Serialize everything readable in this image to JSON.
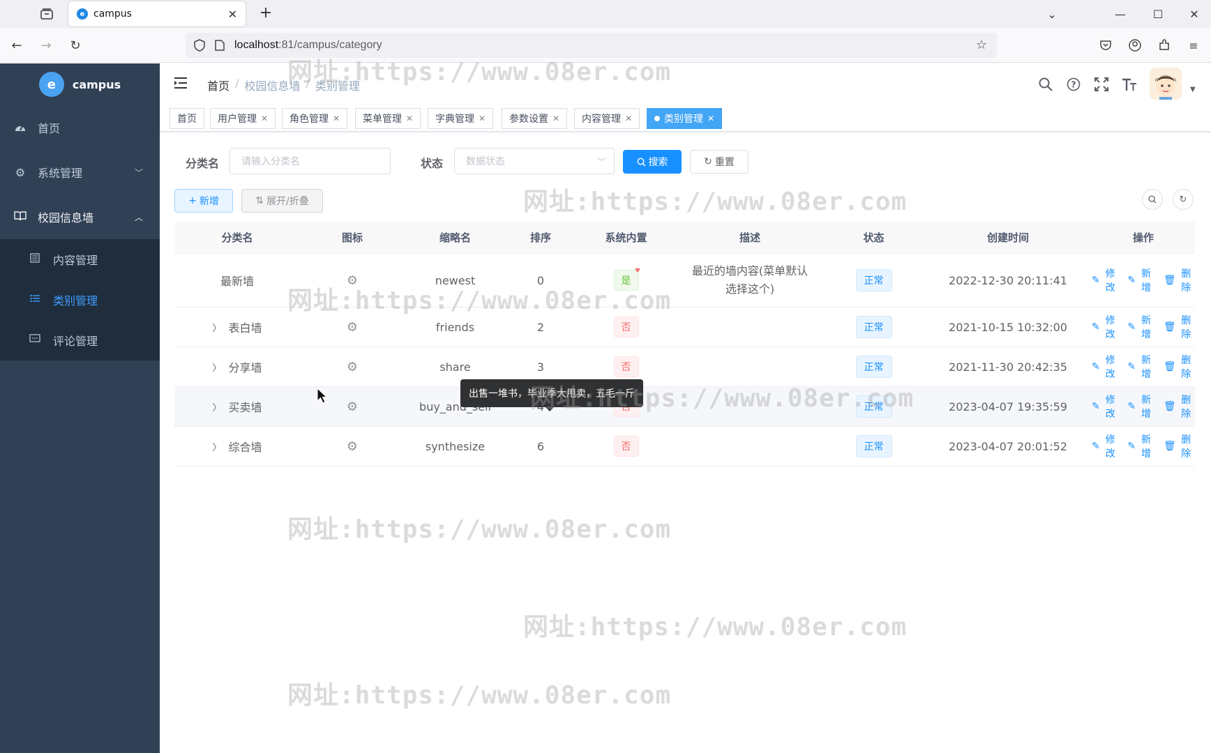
{
  "browser": {
    "tab_title": "campus",
    "url_host": "localhost",
    "url_path": ":81/campus/category"
  },
  "sidebar": {
    "logo_text": "campus",
    "items": [
      {
        "label": "首页",
        "icon": "dashboard-icon"
      },
      {
        "label": "系统管理",
        "icon": "gear-icon"
      },
      {
        "label": "校园信息墙",
        "icon": "book-icon"
      }
    ],
    "subitems": [
      {
        "label": "内容管理",
        "icon": "list-icon"
      },
      {
        "label": "类别管理",
        "icon": "menu-lines-icon",
        "active": true
      },
      {
        "label": "评论管理",
        "icon": "comment-icon"
      }
    ]
  },
  "header": {
    "breadcrumb": [
      "首页",
      "校园信息墙",
      "类别管理"
    ]
  },
  "tagsview": [
    "首页",
    "用户管理",
    "角色管理",
    "菜单管理",
    "字典管理",
    "参数设置",
    "内容管理",
    "类别管理"
  ],
  "search": {
    "name_label": "分类名",
    "name_placeholder": "请输入分类名",
    "status_label": "状态",
    "status_placeholder": "数据状态",
    "search_btn": "搜索",
    "reset_btn": "重置"
  },
  "toolbar": {
    "add_btn": "新增",
    "expand_btn": "展开/折叠"
  },
  "table": {
    "headers": [
      "分类名",
      "图标",
      "缩略名",
      "排序",
      "系统内置",
      "描述",
      "状态",
      "创建时间",
      "操作"
    ],
    "rows": [
      {
        "name": "最新墙",
        "slug": "newest",
        "order": "0",
        "builtin": "是",
        "desc": "最近的墙内容(菜单默认选择这个)",
        "status": "正常",
        "created": "2022-12-30 20:11:41",
        "expandable": false
      },
      {
        "name": "表白墙",
        "slug": "friends",
        "order": "2",
        "builtin": "否",
        "desc": "",
        "status": "正常",
        "created": "2021-10-15 10:32:00",
        "expandable": true
      },
      {
        "name": "分享墙",
        "slug": "share",
        "order": "3",
        "builtin": "否",
        "desc": "",
        "status": "正常",
        "created": "2021-11-30 20:42:35",
        "expandable": true
      },
      {
        "name": "买卖墙",
        "slug": "buy_and_sell",
        "order": "4",
        "builtin": "否",
        "desc": "",
        "status": "正常",
        "created": "2023-04-07 19:35:59",
        "expandable": true
      },
      {
        "name": "综合墙",
        "slug": "synthesize",
        "order": "6",
        "builtin": "否",
        "desc": "",
        "status": "正常",
        "created": "2023-04-07 20:01:52",
        "expandable": true
      }
    ],
    "ops": {
      "edit": "修改",
      "add": "新增",
      "delete": "删除"
    }
  },
  "tooltip": "出售一堆书，毕业季大甩卖，五毛一斤",
  "watermark": "网址:https://www.08er.com",
  "colors": {
    "sidebar": "#304156",
    "primary": "#1890ff",
    "success": "#67c23a",
    "danger": "#f56c6c"
  }
}
